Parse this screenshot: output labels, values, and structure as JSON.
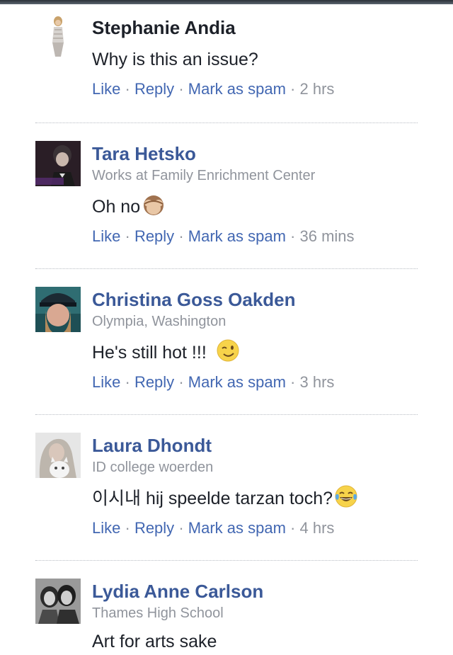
{
  "colors": {
    "name_link": "#3b5998",
    "action_link": "#4267b2",
    "meta_gray": "#90949c",
    "text": "#1d2129"
  },
  "comments": [
    {
      "name": "Stephanie Andia",
      "subtitle": "",
      "text": "Why is this an issue?",
      "emoji": "",
      "actions": {
        "like": "Like",
        "reply": "Reply",
        "spam": "Mark as spam",
        "time": "2 hrs"
      }
    },
    {
      "name": "Tara Hetsko",
      "subtitle": "Works at Family Enrichment Center",
      "text": "Oh no",
      "emoji": "monkey-see-no-evil-emoji",
      "actions": {
        "like": "Like",
        "reply": "Reply",
        "spam": "Mark as spam",
        "time": "36 mins"
      }
    },
    {
      "name": "Christina Goss Oakden",
      "subtitle": "Olympia, Washington",
      "text": "He's still hot !!!",
      "emoji": "winking-face-emoji",
      "actions": {
        "like": "Like",
        "reply": "Reply",
        "spam": "Mark as spam",
        "time": "3 hrs"
      }
    },
    {
      "name": "Laura Dhondt",
      "subtitle": "ID college woerden",
      "text": "이시내 hij speelde tarzan toch?",
      "emoji": "tears-of-joy-emoji",
      "actions": {
        "like": "Like",
        "reply": "Reply",
        "spam": "Mark as spam",
        "time": "4 hrs"
      }
    },
    {
      "name": "Lydia Anne Carlson",
      "subtitle": "Thames High School",
      "text": "Art for arts sake",
      "emoji": "",
      "actions": null
    }
  ]
}
